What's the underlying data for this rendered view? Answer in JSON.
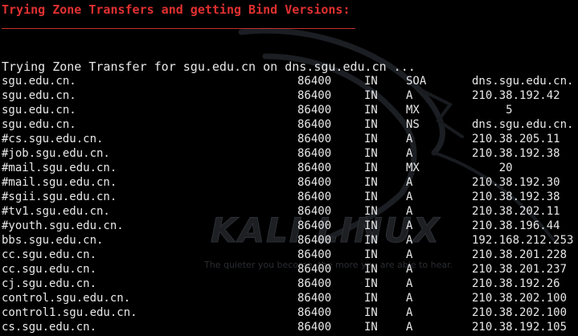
{
  "terminal": {
    "heading": "Trying Zone Transfers and getting Bind Versions:",
    "status_line": "Trying Zone Transfer for sgu.edu.cn on dns.sgu.edu.cn ...",
    "records": [
      {
        "host": "sgu.edu.cn.",
        "ttl": "86400",
        "class": "IN",
        "type": "SOA",
        "value": "dns.sgu.edu.cn."
      },
      {
        "host": "sgu.edu.cn.",
        "ttl": "86400",
        "class": "IN",
        "type": "A",
        "value": "210.38.192.42"
      },
      {
        "host": "sgu.edu.cn.",
        "ttl": "86400",
        "class": "IN",
        "type": "MX",
        "value": "     5"
      },
      {
        "host": "sgu.edu.cn.",
        "ttl": "86400",
        "class": "IN",
        "type": "NS",
        "value": "dns.sgu.edu.cn."
      },
      {
        "host": "#cs.sgu.edu.cn.",
        "ttl": "86400",
        "class": "IN",
        "type": "A",
        "value": "210.38.205.11"
      },
      {
        "host": "#job.sgu.edu.cn.",
        "ttl": "86400",
        "class": "IN",
        "type": "A",
        "value": "210.38.192.38"
      },
      {
        "host": "#mail.sgu.edu.cn.",
        "ttl": "86400",
        "class": "IN",
        "type": "MX",
        "value": "    20"
      },
      {
        "host": "#mail.sgu.edu.cn.",
        "ttl": "86400",
        "class": "IN",
        "type": "A",
        "value": "210.38.192.30"
      },
      {
        "host": "#sgii.sgu.edu.cn.",
        "ttl": "86400",
        "class": "IN",
        "type": "A",
        "value": "210.38.192.38"
      },
      {
        "host": "#tv1.sgu.edu.cn.",
        "ttl": "86400",
        "class": "IN",
        "type": "A",
        "value": "210.38.202.11"
      },
      {
        "host": "#youth.sgu.edu.cn.",
        "ttl": "86400",
        "class": "IN",
        "type": "A",
        "value": "210.38.196.44"
      },
      {
        "host": "bbs.sgu.edu.cn.",
        "ttl": "86400",
        "class": "IN",
        "type": "A",
        "value": "192.168.212.253"
      },
      {
        "host": "cc.sgu.edu.cn.",
        "ttl": "86400",
        "class": "IN",
        "type": "A",
        "value": "210.38.201.228"
      },
      {
        "host": "cc.sgu.edu.cn.",
        "ttl": "86400",
        "class": "IN",
        "type": "A",
        "value": "210.38.201.237"
      },
      {
        "host": "cj.sgu.edu.cn.",
        "ttl": "86400",
        "class": "IN",
        "type": "A",
        "value": "210.38.192.26"
      },
      {
        "host": "control.sgu.edu.cn.",
        "ttl": "86400",
        "class": "IN",
        "type": "A",
        "value": "210.38.202.100"
      },
      {
        "host": "control1.sgu.edu.cn.",
        "ttl": "86400",
        "class": "IN",
        "type": "A",
        "value": "210.38.202.100"
      },
      {
        "host": "cs.sgu.edu.cn.",
        "ttl": "86400",
        "class": "IN",
        "type": "A",
        "value": "210.38.192.105"
      }
    ]
  },
  "wallpaper": {
    "logo_text": "KALI LINUX",
    "tagline": "The quieter you become, the more you are able to hear.",
    "dragon_icon": "kali-dragon-icon"
  },
  "colors": {
    "background": "#000000",
    "heading": "#e03030",
    "text": "#e8e8e8",
    "watermark": "#1d1f23"
  }
}
